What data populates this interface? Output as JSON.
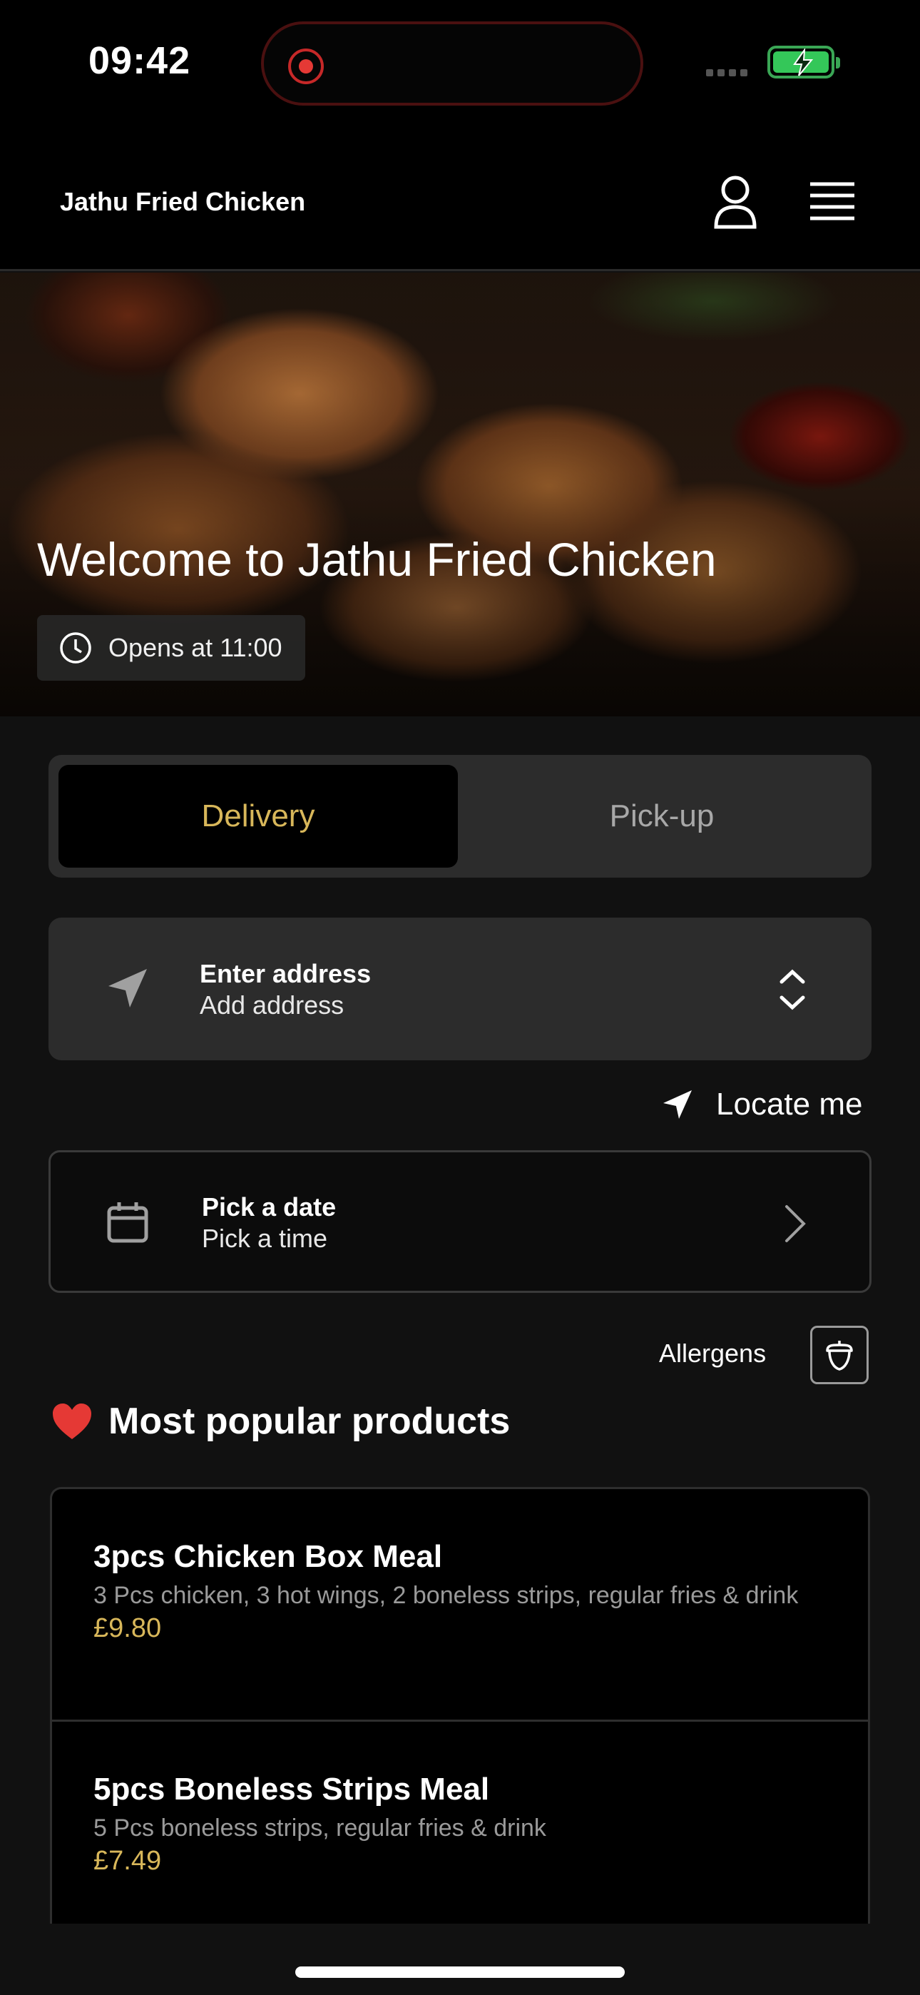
{
  "status_bar": {
    "time": "09:42"
  },
  "header": {
    "brand": "Jathu Fried Chicken"
  },
  "hero": {
    "title": "Welcome to Jathu Fried Chicken",
    "hours": "Opens at 11:00"
  },
  "order_mode": {
    "options": [
      "Delivery",
      "Pick-up"
    ],
    "selected": "Delivery"
  },
  "address": {
    "title": "Enter address",
    "subtitle": "Add address"
  },
  "locate": {
    "label": "Locate me"
  },
  "schedule": {
    "title": "Pick a date",
    "subtitle": "Pick a time"
  },
  "allergens": {
    "label": "Allergens"
  },
  "popular": {
    "title": "Most popular products",
    "products": [
      {
        "name": "3pcs Chicken Box Meal",
        "description": "3 Pcs chicken, 3 hot wings, 2 boneless strips, regular fries & drink",
        "price": "£9.80"
      },
      {
        "name": "5pcs Boneless Strips Meal",
        "description": "5 Pcs boneless strips, regular fries & drink",
        "price": "£7.49"
      }
    ]
  },
  "colors": {
    "accent": "#d8b75a",
    "background": "#111111",
    "card": "#2c2c2c"
  }
}
